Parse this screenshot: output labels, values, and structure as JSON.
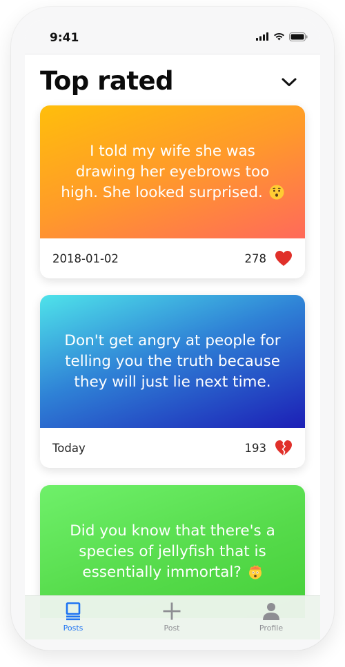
{
  "status_bar": {
    "time": "9:41"
  },
  "header": {
    "title": "Top rated"
  },
  "cards": [
    {
      "text": "I told my wife she was drawing her eyebrows too high. She looked surprised.",
      "emoji": "hushed-face-emoji",
      "date": "2018-01-02",
      "count": "278",
      "heart": "red-heart-icon"
    },
    {
      "text": "Don't get angry at people for telling you the truth because they will just lie next time.",
      "date": "Today",
      "count": "193",
      "heart": "broken-heart-icon"
    },
    {
      "text": "Did you know that there's a species of jellyfish that is essentially immortal?",
      "emoji": "exploding-head-emoji"
    }
  ],
  "tabs": [
    {
      "label": "Posts",
      "icon": "posts-icon",
      "active": true
    },
    {
      "label": "Post",
      "icon": "plus-icon",
      "active": false
    },
    {
      "label": "Profile",
      "icon": "person-icon",
      "active": false
    }
  ],
  "colors": {
    "accent": "#1d73f2",
    "inactive_tab": "#8e8e93",
    "heart_red": "#e0302a",
    "card1_gradient": [
      "#ffbe0b",
      "#ff6a5a"
    ],
    "card2_gradient": [
      "#4fe3ea",
      "#1c1fb6"
    ],
    "card3_gradient": [
      "#6ff06a",
      "#45cf39"
    ]
  }
}
